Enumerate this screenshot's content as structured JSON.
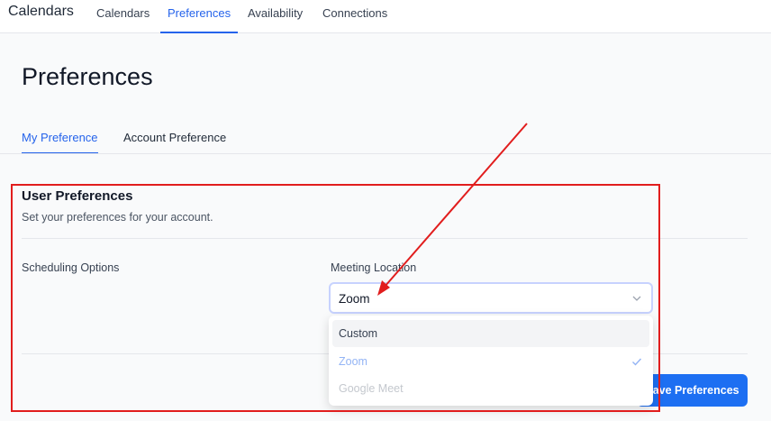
{
  "app": {
    "title": "Calendars"
  },
  "nav": {
    "items": [
      {
        "label": "Calendars"
      },
      {
        "label": "Preferences",
        "active": true
      },
      {
        "label": "Availability"
      },
      {
        "label": "Connections"
      }
    ]
  },
  "page": {
    "title": "Preferences"
  },
  "subtabs": [
    {
      "label": "My Preference",
      "active": true
    },
    {
      "label": "Account Preference"
    }
  ],
  "section": {
    "title": "User Preferences",
    "description": "Set your preferences for your account."
  },
  "scheduling": {
    "row_label": "Scheduling Options",
    "field_label": "Meeting Location",
    "selected_value": "Zoom",
    "options": [
      {
        "label": "Custom",
        "state": "hover"
      },
      {
        "label": "Zoom",
        "state": "selected"
      },
      {
        "label": "Google Meet",
        "state": "disabled"
      }
    ]
  },
  "actions": {
    "save_label": "Save Preferences"
  },
  "colors": {
    "accent": "#2563eb",
    "button": "#1d6ff2",
    "annotation": "#e11d1d"
  },
  "icons": {
    "select_chevron": "chevron-down-icon",
    "selected_check": "check-icon"
  }
}
